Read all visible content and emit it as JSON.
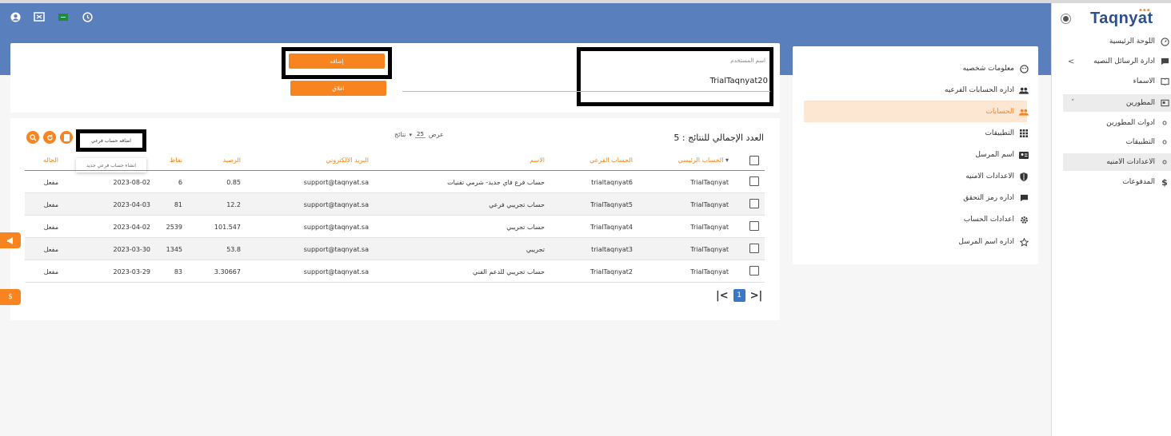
{
  "colors": {
    "accent": "#f7841e",
    "header_blue": "#5a7fbd",
    "brand": "#2c4f8c"
  },
  "top_icons": [
    "user-circle-icon",
    "fullscreen-icon",
    "flag-icon",
    "clock-icon"
  ],
  "brand": {
    "name": "Taqnyat"
  },
  "sidebar": {
    "items": [
      {
        "label": "اللوحة الرئيسية",
        "icon": "dashboard-icon"
      },
      {
        "label": "ادارة الرسائل النصيه",
        "icon": "message-icon"
      },
      {
        "label": "الاسماء",
        "icon": "book-icon"
      },
      {
        "label": "المطورين",
        "icon": "developer-icon"
      },
      {
        "label": "ادوات المطورين",
        "icon": "dot-icon"
      },
      {
        "label": "التطبيقات",
        "icon": "dot-icon"
      },
      {
        "label": "الاعدادات الامنيه",
        "icon": "dot-icon"
      },
      {
        "label": "المدفوعات",
        "icon": "dollar-icon"
      }
    ]
  },
  "form": {
    "username_label": "اسم المستخدم",
    "username_value": "TrialTaqnyat20",
    "submit_label": "إضافه",
    "close_label": "اغلاق"
  },
  "settings": {
    "items": [
      {
        "label": "معلومات شخصيه",
        "icon": "smile-icon"
      },
      {
        "label": "اداره الحسابات الفرعيه",
        "icon": "people-icon"
      },
      {
        "label": "الحسابات",
        "icon": "people-icon"
      },
      {
        "label": "التطبيقات",
        "icon": "grid-icon"
      },
      {
        "label": "اسم المرسل",
        "icon": "id-card-icon"
      },
      {
        "label": "الاعدادات الامنيه",
        "icon": "shield-icon"
      },
      {
        "label": "اداره رمز التحقق",
        "icon": "chat-icon"
      },
      {
        "label": "اعدادات الحساب",
        "icon": "gear-icon"
      },
      {
        "label": "اداره اسم المرسل",
        "icon": "star-icon"
      }
    ]
  },
  "table": {
    "total_label": "العدد الإجمالي للنتائج : 5",
    "show_label": "عرض",
    "page_size": "25",
    "results_label": "نتائج",
    "add_tooltip": "اضافه حساب فرعي",
    "dropdown_item": "انشاء حساب فرعي جديد",
    "columns": [
      "الحساب الرئيسي",
      "الحساب الفرعي",
      "الاسم",
      "البريد الالكتروني",
      "الرصيد",
      "نقاط",
      "",
      "الحاله"
    ],
    "rows": [
      [
        "TrialTaqnyat",
        "trialtaqnyat6",
        "حساب فرع فاي جديد- شرمي تقنيات",
        "support@taqnyat.sa",
        "0.85",
        "6",
        "2023-08-02",
        "مفعل"
      ],
      [
        "TrialTaqnyat",
        "TrialTaqnyat5",
        "حساب تجريبي فرعي",
        "support@taqnyat.sa",
        "12.2",
        "81",
        "2023-04-03",
        "مفعل"
      ],
      [
        "TrialTaqnyat",
        "TrialTaqnyat4",
        "حساب تجريبي",
        "support@taqnyat.sa",
        "101.547",
        "2539",
        "2023-04-02",
        "مفعل"
      ],
      [
        "TrialTaqnyat",
        "trialtaqnyat3",
        "تجريبي",
        "support@taqnyat.sa",
        "53.8",
        "1345",
        "2023-03-30",
        "مفعل"
      ],
      [
        "TrialTaqnyat",
        "TrialTaqnyat2",
        "حساب تجريبي للدعم الفني",
        "support@taqnyat.sa",
        "3.30667",
        "83",
        "2023-03-29",
        "مفعل"
      ]
    ],
    "current_page": "1"
  }
}
